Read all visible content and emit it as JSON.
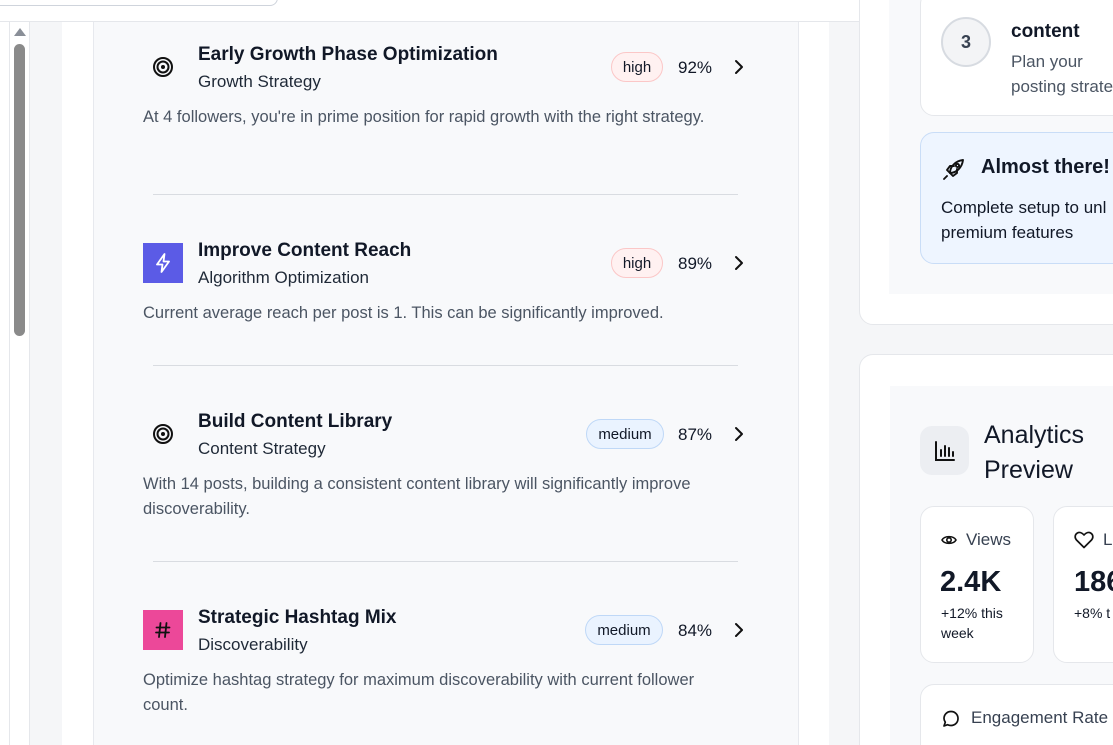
{
  "recommendations": [
    {
      "title": "Early Growth Phase Optimization",
      "category": "Growth Strategy",
      "priority": "high",
      "score": "92%",
      "icon": "target-icon",
      "description": "At 4 followers, you're in prime position for rapid growth with the right strategy."
    },
    {
      "title": "Improve Content Reach",
      "category": "Algorithm Optimization",
      "priority": "high",
      "score": "89%",
      "icon": "lightning-icon",
      "description": "Current average reach per post is 1. This can be significantly improved."
    },
    {
      "title": "Build Content Library",
      "category": "Content Strategy",
      "priority": "medium",
      "score": "87%",
      "icon": "target-icon",
      "description": "With 14 posts, building a consistent content library will significantly improve discoverability."
    },
    {
      "title": "Strategic Hashtag Mix",
      "category": "Discoverability",
      "priority": "medium",
      "score": "84%",
      "icon": "hashtag-icon",
      "description": "Optimize hashtag strategy for maximum discoverability with current follower count."
    }
  ],
  "setup": {
    "step_number": "3",
    "step_title": "content",
    "step_desc": "Plan your posting strate",
    "almost_title": "Almost there!",
    "almost_desc": "Complete setup to unl premium features"
  },
  "analytics": {
    "title": "Analytics Preview",
    "stats": [
      {
        "label": "Views",
        "value": "2.4K",
        "change": "+12% this week",
        "icon": "eye-icon"
      },
      {
        "label": "L",
        "value": "186",
        "change": "+8% t week",
        "icon": "heart-icon"
      }
    ],
    "engagement_label": "Engagement Rate"
  },
  "colors": {
    "accent_purple": "#5b5be6",
    "accent_pink": "#ec4899",
    "high_badge_bg": "#fff1f1",
    "medium_badge_bg": "#eaf3ff"
  }
}
